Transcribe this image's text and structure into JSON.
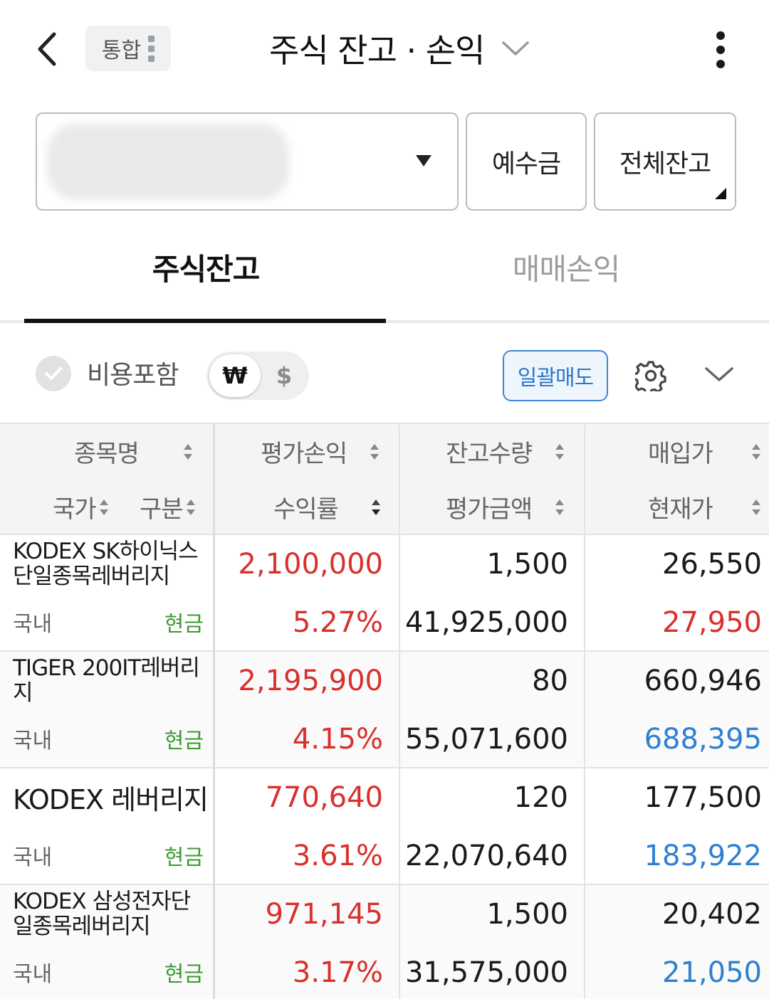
{
  "header": {
    "scope_chip": "통합",
    "title": "주식 잔고 · 손익"
  },
  "account": {
    "deposit_button": "예수금",
    "total_balance_button": "전체잔고"
  },
  "tabs": [
    {
      "label": "주식잔고",
      "active": true
    },
    {
      "label": "매매손익",
      "active": false
    }
  ],
  "options": {
    "include_cost_label": "비용포함",
    "currency_won": "₩",
    "currency_usd": "$",
    "bulk_sell_button": "일괄매도"
  },
  "table": {
    "headers": {
      "name": "종목명",
      "country": "국가",
      "category": "구분",
      "eval_profit": "평가손익",
      "return_rate": "수익률",
      "quantity": "잔고수량",
      "eval_amount": "평가금액",
      "buy_price": "매입가",
      "current_price": "현재가"
    },
    "rows": [
      {
        "name": "KODEX SK하이닉스단일종목레버리지",
        "country": "국내",
        "category": "현금",
        "eval_profit": "2,100,000",
        "return_rate": "5.27%",
        "quantity": "1,500",
        "eval_amount": "41,925,000",
        "buy_price": "26,550",
        "current_price": "27,950",
        "current_price_color": "#d9302c"
      },
      {
        "name": "TIGER 200IT레버리지",
        "country": "국내",
        "category": "현금",
        "eval_profit": "2,195,900",
        "return_rate": "4.15%",
        "quantity": "80",
        "eval_amount": "55,071,600",
        "buy_price": "660,946",
        "current_price": "688,395",
        "current_price_color": "#2f80d1"
      },
      {
        "name": "KODEX 레버리지",
        "country": "국내",
        "category": "현금",
        "eval_profit": "770,640",
        "return_rate": "3.61%",
        "quantity": "120",
        "eval_amount": "22,070,640",
        "buy_price": "177,500",
        "current_price": "183,922",
        "current_price_color": "#2f80d1"
      },
      {
        "name": "KODEX 삼성전자단일종목레버리지",
        "country": "국내",
        "category": "현금",
        "eval_profit": "971,145",
        "return_rate": "3.17%",
        "quantity": "1,500",
        "eval_amount": "31,575,000",
        "buy_price": "20,402",
        "current_price": "21,050",
        "current_price_color": "#2f80d1"
      }
    ]
  }
}
